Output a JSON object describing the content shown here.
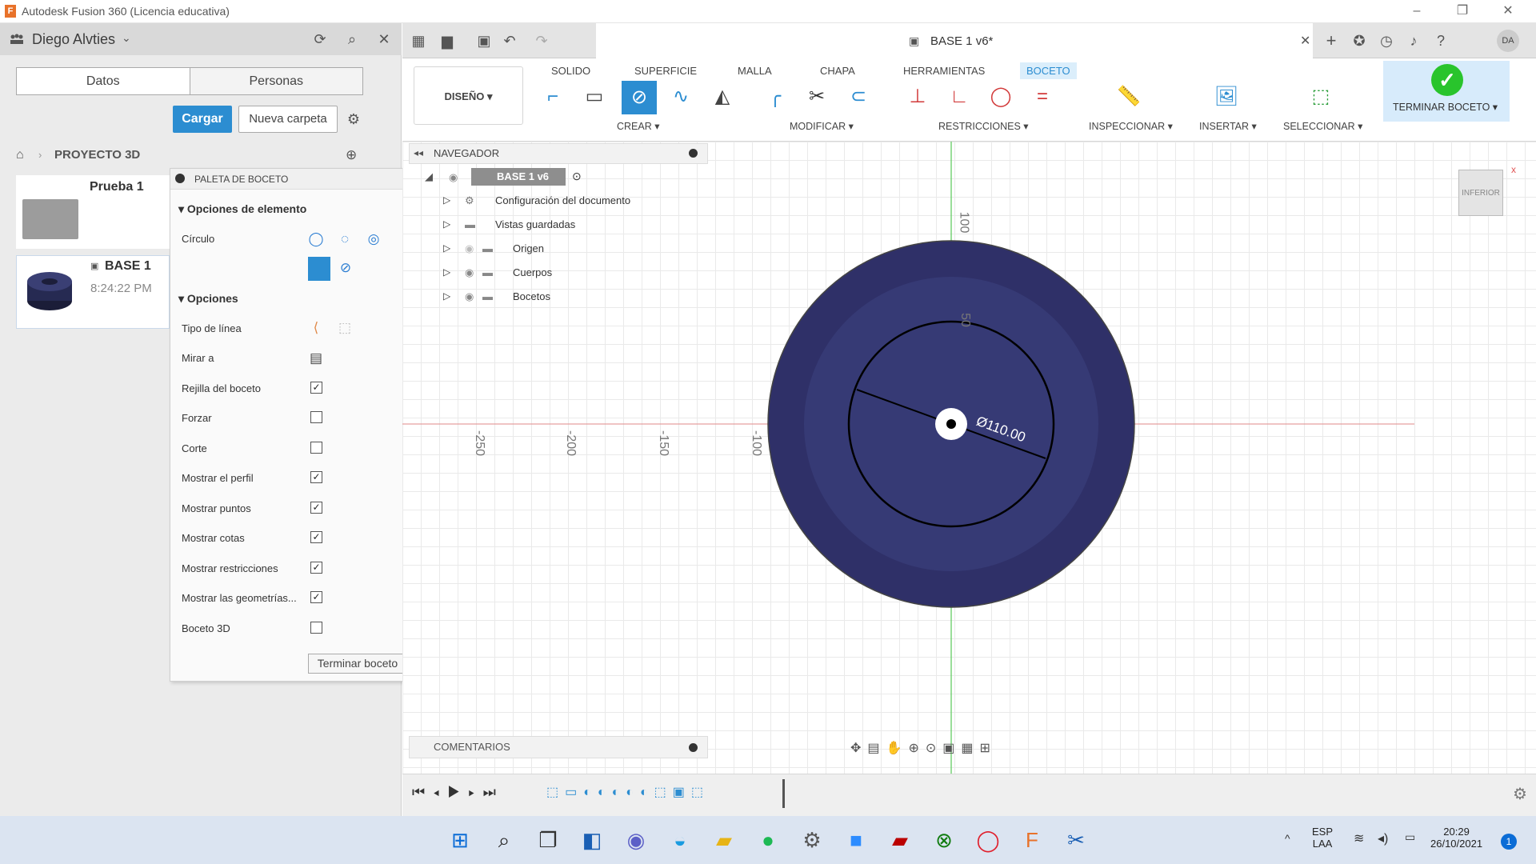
{
  "window": {
    "title": "Autodesk Fusion 360 (Licencia educativa)"
  },
  "data_panel": {
    "user": "Diego Alvties",
    "tabs": [
      "Datos",
      "Personas"
    ],
    "upload_btn": "Cargar",
    "new_folder_btn": "Nueva carpeta",
    "breadcrumb": "PROYECTO 3D",
    "items": [
      {
        "name": "Prueba 1",
        "time": ""
      },
      {
        "name": "BASE 1",
        "time": "8:24:22 PM"
      }
    ]
  },
  "palette": {
    "title": "PALETA DE BOCETO",
    "section_element": "Opciones de elemento",
    "circle_label": "Círculo",
    "section_options": "Opciones",
    "options": [
      {
        "label": "Tipo de línea",
        "type": "icon"
      },
      {
        "label": "Mirar a",
        "type": "icon"
      },
      {
        "label": "Rejilla del boceto",
        "checked": true
      },
      {
        "label": "Forzar",
        "checked": false
      },
      {
        "label": "Corte",
        "checked": false
      },
      {
        "label": "Mostrar el perfil",
        "checked": true
      },
      {
        "label": "Mostrar puntos",
        "checked": true
      },
      {
        "label": "Mostrar cotas",
        "checked": true
      },
      {
        "label": "Mostrar restricciones",
        "checked": true
      },
      {
        "label": "Mostrar las geometrías...",
        "checked": true
      },
      {
        "label": "Boceto 3D",
        "checked": false
      }
    ],
    "finish_btn": "Terminar boceto"
  },
  "document": {
    "tab_title": "BASE 1 v6*"
  },
  "ribbon": {
    "tabs": [
      "SOLIDO",
      "SUPERFICIE",
      "MALLA",
      "CHAPA",
      "HERRAMIENTAS",
      "BOCETO"
    ],
    "active_tab": "BOCETO",
    "workspace": "DISEÑO",
    "groups": [
      "CREAR",
      "MODIFICAR",
      "RESTRICCIONES",
      "INSPECCIONAR",
      "INSERTAR",
      "SELECCIONAR"
    ],
    "finish": "TERMINAR BOCETO"
  },
  "navigator": {
    "title": "NAVEGADOR",
    "root": "BASE 1 v6",
    "items": [
      "Configuración del documento",
      "Vistas guardadas",
      "Origen",
      "Cuerpos",
      "Bocetos"
    ]
  },
  "comments": {
    "title": "COMENTARIOS"
  },
  "sketch": {
    "dimension": "Ø110.00",
    "h_ticks": [
      "-250",
      "-200",
      "-150",
      "-100"
    ],
    "v_ticks": [
      "100",
      "50"
    ]
  },
  "viewcube": {
    "label": "INFERIOR"
  },
  "taskbar": {
    "lang": "ESP",
    "lang2": "LAA",
    "time": "20:29",
    "date": "26/10/2021",
    "badge": "1"
  },
  "colors": {
    "accent": "#2c8dd1",
    "body": "#2f3068",
    "ok": "#29c42c"
  }
}
